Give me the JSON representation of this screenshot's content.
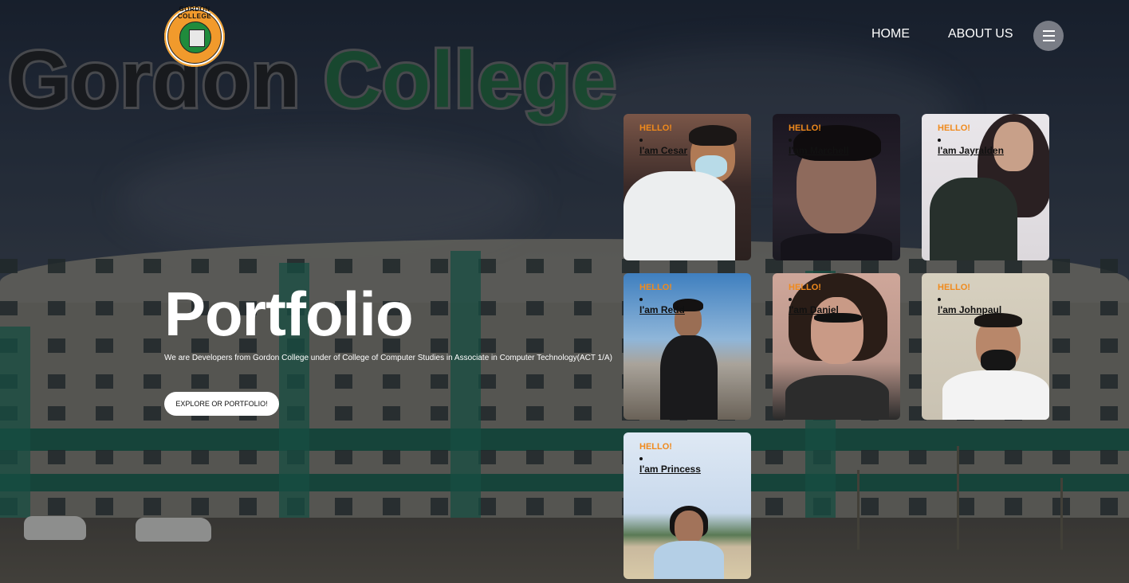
{
  "header": {
    "logo_text": "GORDON COLLEGE",
    "nav": [
      {
        "label": "HOME"
      },
      {
        "label": "ABOUT US"
      }
    ]
  },
  "background": {
    "word1": "Gordon",
    "word2": "College"
  },
  "hero": {
    "title": "Portfolio",
    "subtitle": "We are Developers from Gordon College under of College of Computer Studies in Associate in Computer Technology(ACT 1/A)",
    "cta_label": "EXPLORE OR PORTFOLIO!"
  },
  "cards": [
    {
      "hello": "HELLO!",
      "name": "I'am Cesar"
    },
    {
      "hello": "HELLO!",
      "name": "I'am Marchell"
    },
    {
      "hello": "HELLO!",
      "name": "I'am Jayralden"
    },
    {
      "hello": "HELLO!",
      "name": "I'am Redd"
    },
    {
      "hello": "HELLO!",
      "name": "I'am Daniel"
    },
    {
      "hello": "HELLO!",
      "name": "I'am Johnpaul"
    },
    {
      "hello": "HELLO!",
      "name": "I'am Princess"
    }
  ],
  "colors": {
    "accent": "#f08a1c",
    "brand_green": "#1d6a3a"
  },
  "icons": {
    "menu": "hamburger-icon"
  }
}
